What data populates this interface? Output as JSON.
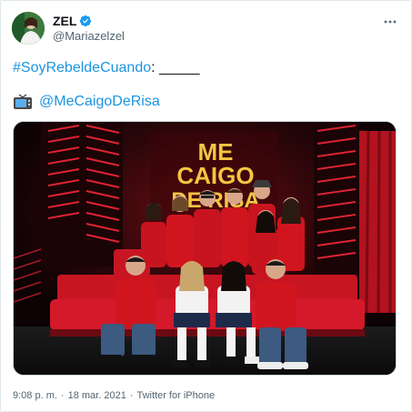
{
  "author": {
    "display_name": "ZEL",
    "handle": "@Mariazelzel"
  },
  "tweet": {
    "hashtag": "#SoyRebeldeCuando",
    "line1_suffix": ": _____",
    "mention": "@MeCaigoDeRisa"
  },
  "media": {
    "sign_line1": "ME",
    "sign_line2": "CAIGO",
    "sign_line3": "DE RISA"
  },
  "footer": {
    "time": "9:08 p. m.",
    "separator1": "·",
    "date": "18 mar. 2021",
    "separator2": "·",
    "source": "Twitter for iPhone"
  },
  "colors": {
    "link": "#1b95e0",
    "verified": "#1d9bf0",
    "secondary_text": "#536471"
  },
  "icons": {
    "verified": "verified-badge-icon",
    "more": "more-options-icon",
    "tv": "television-icon"
  }
}
